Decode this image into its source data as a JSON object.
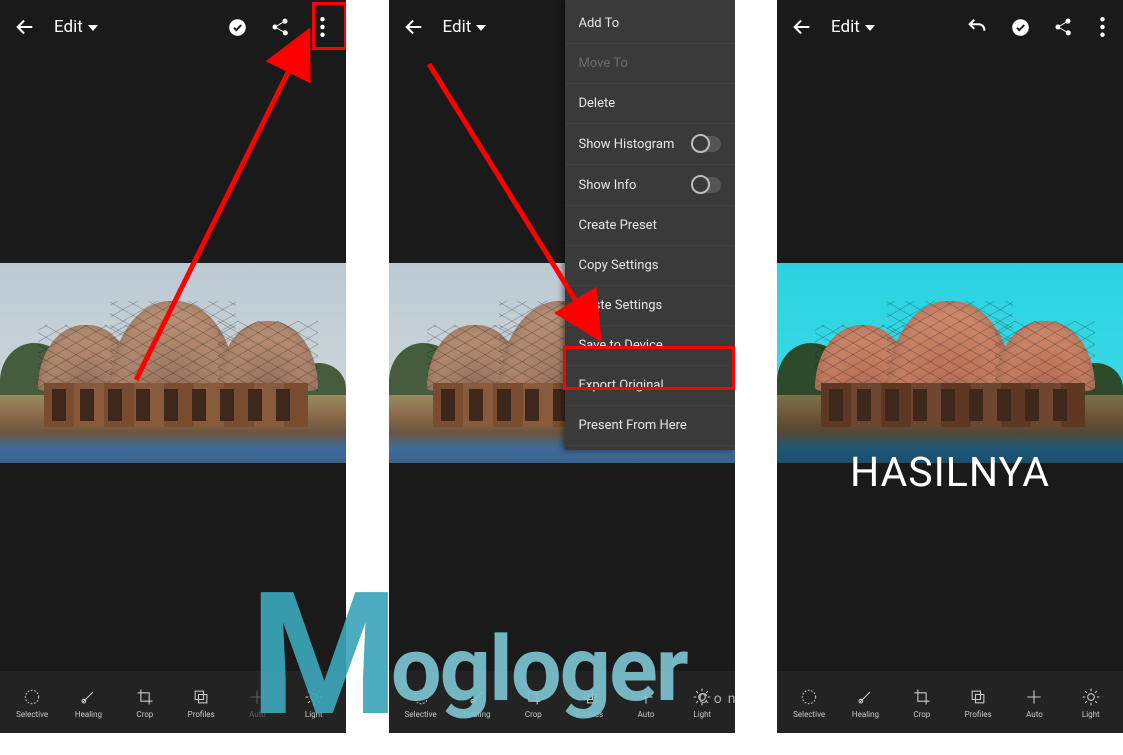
{
  "topbar": {
    "edit_label": "Edit"
  },
  "menu": {
    "add_to": "Add To",
    "move_to": "Move To",
    "delete": "Delete",
    "show_histogram": "Show Histogram",
    "show_info": "Show Info",
    "create_preset": "Create Preset",
    "copy_settings": "Copy Settings",
    "paste_settings": "Paste Settings",
    "save_to_device": "Save to Device",
    "export_original": "Export Original",
    "present_from_here": "Present From Here"
  },
  "tools": {
    "selective": "Selective",
    "healing": "Healing",
    "crop": "Crop",
    "profiles": "Profiles",
    "auto": "Auto",
    "light": "Light"
  },
  "result_label": "HASILNYA",
  "watermark": {
    "m": "M",
    "rest": "ogloger",
    "suffix": "Con"
  }
}
